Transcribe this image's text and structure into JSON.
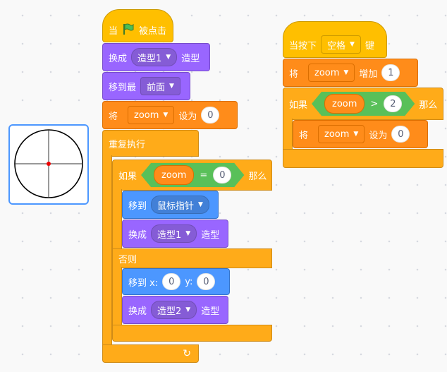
{
  "sprite": {
    "name": "circle-crosshair-costume"
  },
  "script1": {
    "hat": {
      "prefix": "当",
      "suffix": "被点击"
    },
    "switch1": {
      "label": "换成",
      "costume": "造型1",
      "suffix": "造型"
    },
    "front": {
      "label": "移到最",
      "layer": "前面"
    },
    "set1": {
      "label": "将",
      "var": "zoom",
      "mid": "设为",
      "value": "0"
    },
    "forever": {
      "label": "重复执行"
    },
    "if": {
      "label": "如果",
      "var": "zoom",
      "op": "=",
      "value": "0",
      "then": "那么",
      "goto": {
        "label": "移到",
        "target": "鼠标指针"
      },
      "switch": {
        "label": "换成",
        "costume": "造型1",
        "suffix": "造型"
      },
      "else": "否则",
      "gotoxy": {
        "label": "移到 x:",
        "x": "0",
        "ylabel": "y:",
        "y": "0"
      },
      "switch2": {
        "label": "换成",
        "costume": "造型2",
        "suffix": "造型"
      }
    }
  },
  "script2": {
    "hat": {
      "prefix": "当按下",
      "key": "空格",
      "suffix": "键"
    },
    "change": {
      "label": "将",
      "var": "zoom",
      "mid": "增加",
      "value": "1"
    },
    "if": {
      "label": "如果",
      "var": "zoom",
      "op": ">",
      "value": "2",
      "then": "那么",
      "set": {
        "label": "将",
        "var": "zoom",
        "mid": "设为",
        "value": "0"
      }
    }
  },
  "colors": {
    "events": "#ffbf00",
    "looks": "#9966ff",
    "variables": "#ff8c1a",
    "motion": "#4c97ff",
    "control": "#ffab19",
    "operators": "#59c059"
  }
}
